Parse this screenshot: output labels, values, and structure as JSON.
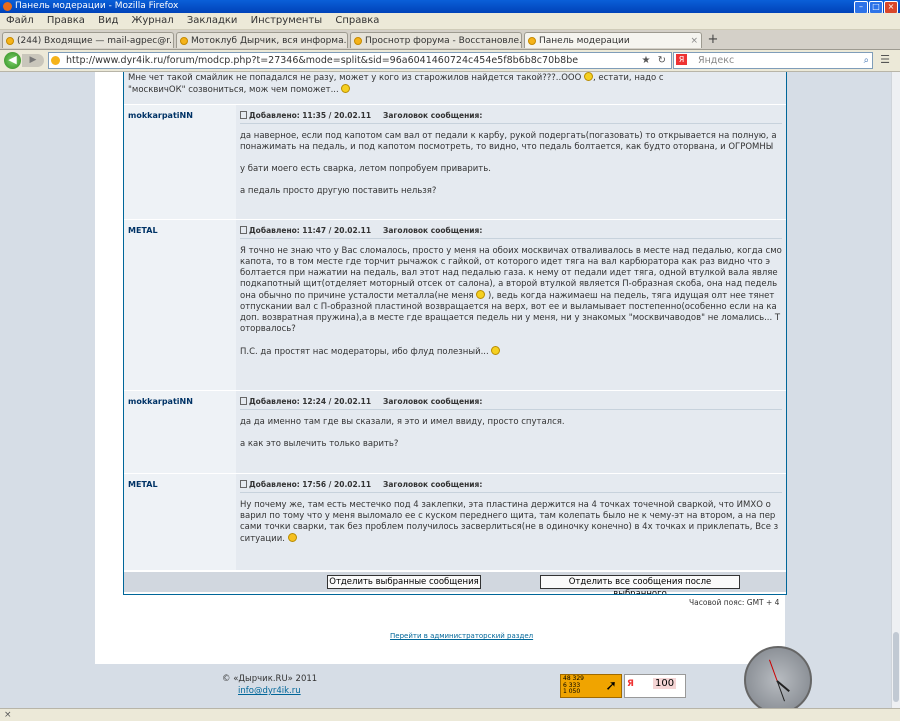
{
  "window": {
    "title": "Панель модерации - Mozilla Firefox"
  },
  "menu": [
    "Файл",
    "Правка",
    "Вид",
    "Журнал",
    "Закладки",
    "Инструменты",
    "Справка"
  ],
  "tabs": [
    {
      "label": "(244) Входящие — mail-agpec@r..."
    },
    {
      "label": "Мотоклуб Дырчик, вся информа..."
    },
    {
      "label": "Проснотр форума - Восстановле..."
    },
    {
      "label": "Панель модерации"
    }
  ],
  "nav": {
    "url": "http://www.dyr4ik.ru/forum/modcp.php?t=27346&mode=split&sid=96a6041460724c454e5f8b6b8c70b8be",
    "search_placeholder": "Яндекс"
  },
  "top_fragment": {
    "line1": "Мне чет такой смайлик не попадался не разу, может у кого из старожилов найдется такой???..ООО",
    "line1b": ", естати, надо с",
    "line2": "\"москвичОК\" созвониться, мож чем поможет..."
  },
  "labels": {
    "added": "Добавлено:",
    "subject": "Заголовок сообщения:"
  },
  "posts": [
    {
      "author": "mokkarpatiNN",
      "time": "11:35 / 20.02.11",
      "paragraphs": [
        [
          "да наверное, если под капотом сам вал от педали к карбу, рукой подергать(погазовать) то открывается на полную, а",
          "понажимать на педаль, и под капотом посмотреть, то видно, что педаль болтается, как будто оторвана, и ОГРОМНЫ"
        ],
        [
          "у бати моего есть сварка, летом попробуем приварить."
        ],
        [
          "а педаль просто другую поставить нельзя?"
        ]
      ]
    },
    {
      "author": "METAL",
      "time": "11:47 / 20.02.11",
      "paragraphs": [
        [
          "Я точно не знаю что у Вас сломалось, просто у меня на обоих москвичах отваливалось в месте над педалью, когда смо",
          "капота, то в том месте где торчит рычажок с гайкой, от которого идет тяга на вал карбюратора как раз видно что э",
          "болтается при нажатии на педаль, вал этот над педалью газа. к нему от педали идет тяга, одной втулкой вала являе",
          "подкапотный щит(отделяет моторный отсек от салона), а второй втулкой является П-образная скоба, она над педель",
          "она обычно по причине усталости металла(не меня",
          "), ведь когда нажимаеш на педель, тяга идущая олт нее тянет",
          "отпускании вал с П-образной пластиной возвращается на верх, вот ее и выламывает постепенно(особенно если на ка",
          "доп. возвратная пружина),а в месте где вращается педель ни у меня, ни у знакомых \"москвичаводов\" не ломались... Т",
          "оторвалось?"
        ],
        [
          "П.С. да простят нас модераторы, ибо флуд полезный..."
        ]
      ]
    },
    {
      "author": "mokkarpatiNN",
      "time": "12:24 / 20.02.11",
      "paragraphs": [
        [
          "да да именно там где вы сказали, я это и имел ввиду, просто спутался."
        ],
        [
          "а как это вылечить только варить?"
        ]
      ]
    },
    {
      "author": "METAL",
      "time": "17:56 / 20.02.11",
      "paragraphs": [
        [
          "Ну почему же, там есть местечко под 4 заклепки, эта пластина держится на 4 точках точечной сваркой, что ИМХО о",
          "варил по тому что у меня выломало ее с куском переднего щита, там колепать было не к чему-эт на втором, а на пер",
          "сами точки сварки, так без проблем получилось засверлиться(не в одиночку конечно) в 4х точках и приклепать, Все з",
          "ситуации."
        ]
      ]
    }
  ],
  "buttons": {
    "split_selected": "Отделить выбранные сообщения",
    "split_after": "Отделить все сообщения после выбранного"
  },
  "timezone": "Часовой пояс: GMT + 4",
  "admin_link": "Перейти в администраторский раздел",
  "footer": {
    "copyright": "© «Дырчик.RU» 2011",
    "email": "info@dyr4ik.ru"
  },
  "counters": {
    "c1_lines": [
      "48 329",
      "6 333",
      "1 050"
    ],
    "c2_value": "100"
  }
}
